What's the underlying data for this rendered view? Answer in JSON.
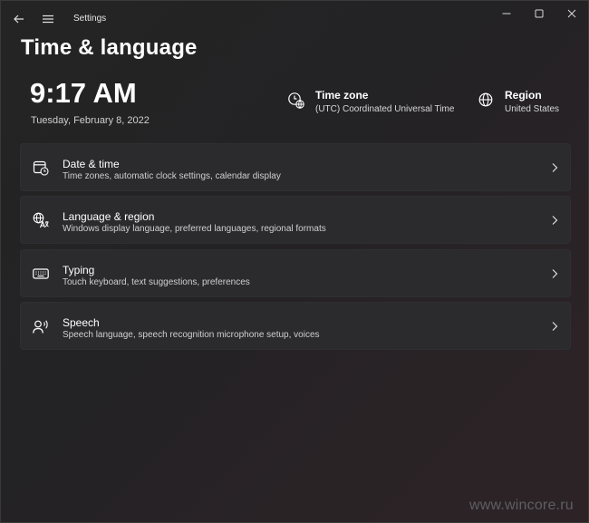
{
  "window": {
    "app_title": "Settings"
  },
  "page": {
    "title": "Time & language"
  },
  "clock": {
    "time": "9:17 AM",
    "date": "Tuesday, February 8, 2022"
  },
  "timezone": {
    "title": "Time zone",
    "value": "(UTC) Coordinated Universal Time",
    "icon": "time-zone-icon"
  },
  "region": {
    "title": "Region",
    "value": "United States",
    "icon": "globe-icon"
  },
  "cards": [
    {
      "title": "Date & time",
      "desc": "Time zones, automatic clock settings, calendar display",
      "icon": "calendar-clock-icon"
    },
    {
      "title": "Language & region",
      "desc": "Windows display language, preferred languages, regional formats",
      "icon": "language-icon"
    },
    {
      "title": "Typing",
      "desc": "Touch keyboard, text suggestions, preferences",
      "icon": "keyboard-icon"
    },
    {
      "title": "Speech",
      "desc": "Speech language, speech recognition microphone setup, voices",
      "icon": "speech-icon"
    }
  ],
  "watermark": "www.wincore.ru"
}
